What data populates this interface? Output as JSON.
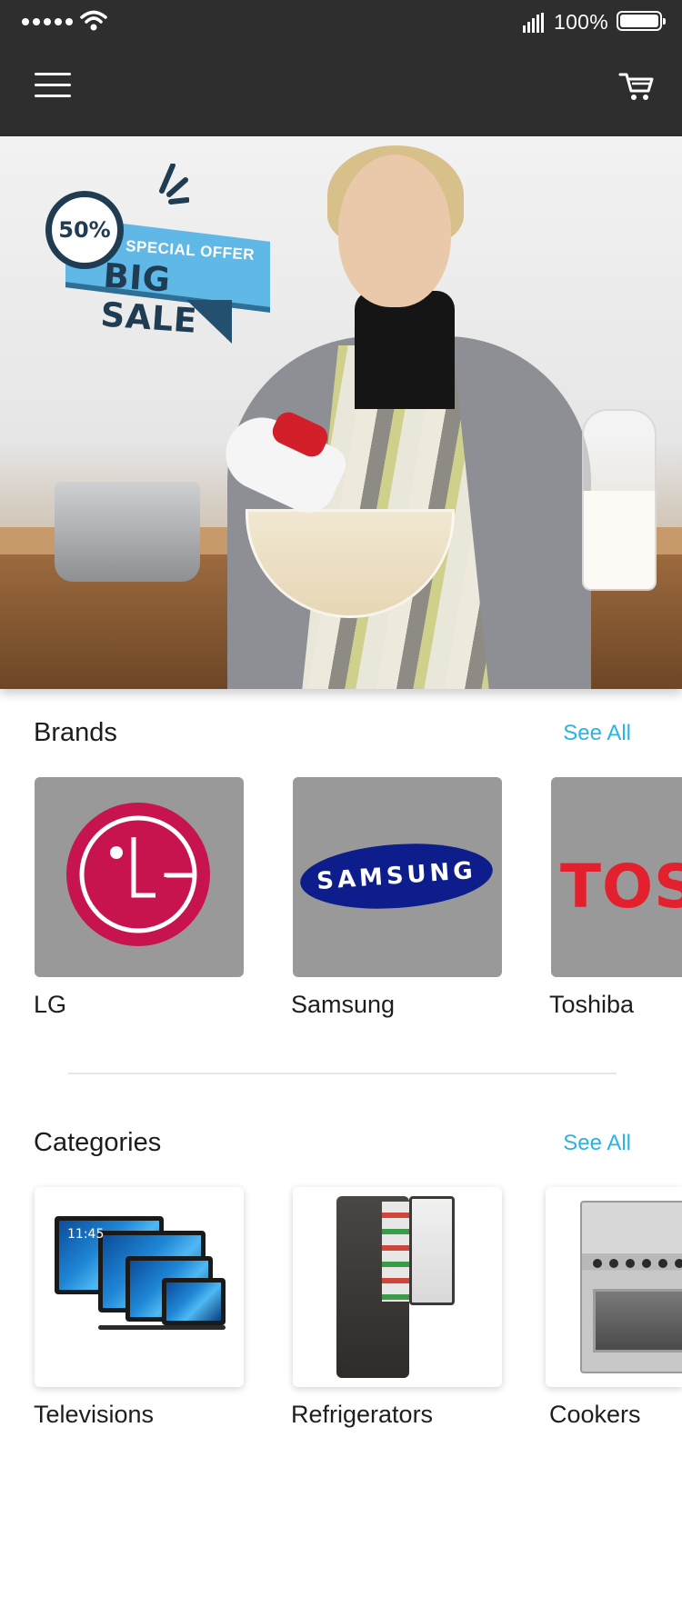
{
  "status_bar": {
    "battery_percent": "100%",
    "signal_icon": "signal-bars-icon",
    "wifi_icon": "wifi-icon",
    "battery_icon": "battery-full-icon"
  },
  "nav": {
    "menu_icon": "hamburger-menu-icon",
    "cart_icon": "shopping-cart-icon",
    "background_color": "#2e2e2e"
  },
  "hero": {
    "badge_percent": "50%",
    "badge_offer": "SPECIAL OFFER",
    "badge_title": "BIG SALE"
  },
  "brands": {
    "title": "Brands",
    "see_all": "See All",
    "items": [
      {
        "label": "LG",
        "logo_text": "",
        "logo_color": "#c7144e"
      },
      {
        "label": "Samsung",
        "logo_text": "SAMSUNG",
        "logo_color": "#0d1e8c"
      },
      {
        "label": "Toshiba",
        "logo_text": "TOS",
        "logo_color": "#e3202d"
      }
    ]
  },
  "categories": {
    "title": "Categories",
    "see_all": "See All",
    "items": [
      {
        "label": "Televisions",
        "tv_time": "11:45"
      },
      {
        "label": "Refrigerators"
      },
      {
        "label": "Cookers"
      }
    ]
  },
  "colors": {
    "accent": "#2bb3e2",
    "brand_tile": "#999999"
  }
}
